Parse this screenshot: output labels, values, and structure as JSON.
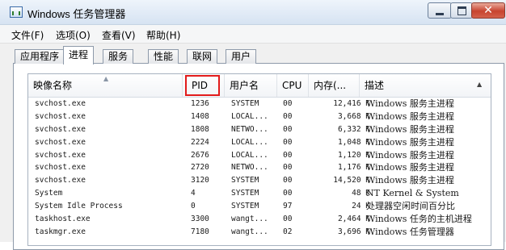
{
  "window": {
    "title": "Windows 任务管理器"
  },
  "menu": [
    "文件(F)",
    "选项(O)",
    "查看(V)",
    "帮助(H)"
  ],
  "tabs": [
    "应用程序",
    "进程",
    "服务",
    "性能",
    "联网",
    "用户"
  ],
  "active_tab": "进程",
  "columns": [
    "映像名称",
    "PID",
    "用户名",
    "CPU",
    "内存(...",
    "描述"
  ],
  "rows": [
    {
      "name": "svchost.exe",
      "pid": "1236",
      "user": "SYSTEM",
      "cpu": "00",
      "mem": "12,416 K",
      "desc": "Windows 服务主进程"
    },
    {
      "name": "svchost.exe",
      "pid": "1408",
      "user": "LOCAL...",
      "cpu": "00",
      "mem": "3,668 K",
      "desc": "Windows 服务主进程"
    },
    {
      "name": "svchost.exe",
      "pid": "1808",
      "user": "NETWO...",
      "cpu": "00",
      "mem": "6,332 K",
      "desc": "Windows 服务主进程"
    },
    {
      "name": "svchost.exe",
      "pid": "2224",
      "user": "LOCAL...",
      "cpu": "00",
      "mem": "1,048 K",
      "desc": "Windows 服务主进程"
    },
    {
      "name": "svchost.exe",
      "pid": "2676",
      "user": "LOCAL...",
      "cpu": "00",
      "mem": "1,120 K",
      "desc": "Windows 服务主进程"
    },
    {
      "name": "svchost.exe",
      "pid": "2720",
      "user": "NETWO...",
      "cpu": "00",
      "mem": "1,176 K",
      "desc": "Windows 服务主进程"
    },
    {
      "name": "svchost.exe",
      "pid": "3120",
      "user": "SYSTEM",
      "cpu": "00",
      "mem": "14,520 K",
      "desc": "Windows 服务主进程"
    },
    {
      "name": "System",
      "pid": "4",
      "user": "SYSTEM",
      "cpu": "00",
      "mem": "48 K",
      "desc": "NT Kernel & System"
    },
    {
      "name": "System Idle Process",
      "pid": "0",
      "user": "SYSTEM",
      "cpu": "97",
      "mem": "24 K",
      "desc": "处理器空闲时间百分比"
    },
    {
      "name": "taskhost.exe",
      "pid": "3300",
      "user": "wangt...",
      "cpu": "00",
      "mem": "2,464 K",
      "desc": "Windows 任务的主机进程"
    },
    {
      "name": "taskmgr.exe",
      "pid": "7180",
      "user": "wangt...",
      "cpu": "02",
      "mem": "3,696 K",
      "desc": "Windows 任务管理器"
    }
  ],
  "colors": {
    "highlight": "#e21b1b",
    "close_button": "#c7442f"
  },
  "icons": [
    "app-icon",
    "minimize-icon",
    "maximize-icon",
    "close-icon",
    "sort-arrow-icon",
    "scroll-up-icon"
  ]
}
